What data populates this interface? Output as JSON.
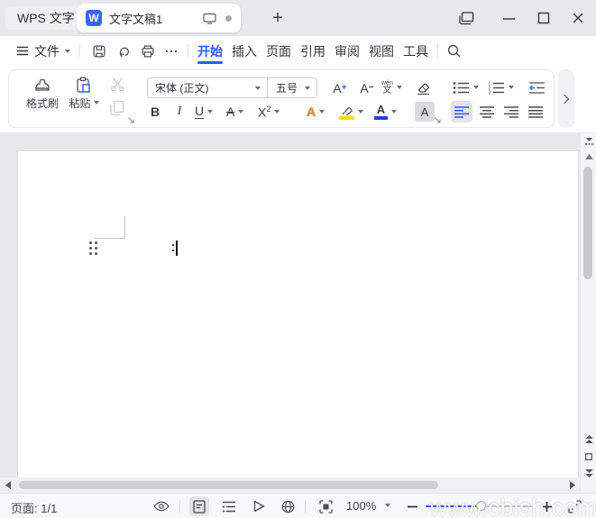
{
  "titlebar": {
    "app_label": "WPS 文字",
    "doc_logo_glyph": "W",
    "doc_tab_title": "文字文稿1",
    "new_tab_glyph": "+"
  },
  "menubar": {
    "file_label": "文件",
    "tabs": [
      "开始",
      "插入",
      "页面",
      "引用",
      "审阅",
      "视图",
      "工具"
    ],
    "active_tab": "开始"
  },
  "ribbon": {
    "format_painter_label": "格式刷",
    "paste_label": "粘贴",
    "font_name": "宋体 (正文)",
    "font_size": "五号",
    "glyphs": {
      "grow_base": "A",
      "grow_sign": "+",
      "shrink_base": "A",
      "shrink_sign": "−",
      "pinyin_top": "wén",
      "pinyin_bottom": "文",
      "bold": "B",
      "italic": "I",
      "underline": "U",
      "strikethrough": "A",
      "sup_base": "X",
      "sup_exp": "2",
      "text_effect": "A",
      "font_color": "A",
      "char_shading": "A"
    }
  },
  "statusbar": {
    "page_indicator": "页面: 1/1",
    "zoom_level": "100%"
  },
  "watermark": "www.cbish.com",
  "colors": {
    "accent": "#2C5BF2",
    "highlight_yellow": "#F2E000",
    "font_color_bar": "#2143C7",
    "disabled_icon": "#C9CBCF",
    "titlebar_bg": "#E6E8EB",
    "doc_bg": "#E6E8EB"
  }
}
